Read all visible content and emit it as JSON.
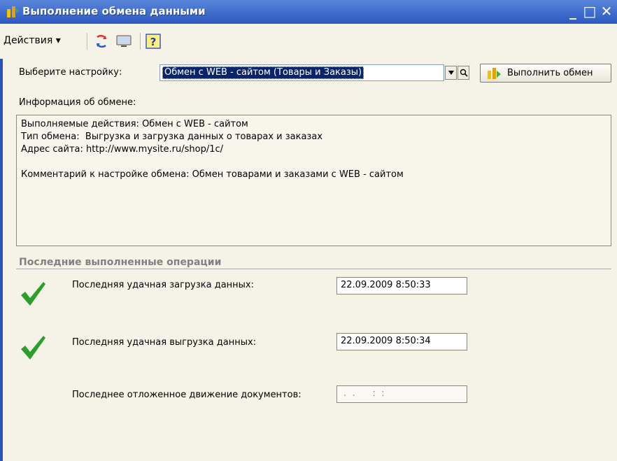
{
  "window": {
    "title": "Выполнение обмена данными",
    "minimize": "_",
    "maximize": "□",
    "close": "✕"
  },
  "toolbar": {
    "actions_label": "Действия ▾",
    "icons": [
      "refresh-icon",
      "monitor-icon",
      "help-icon"
    ]
  },
  "setting": {
    "label": "Выберите настройку:",
    "selected_value": "Обмен с WEB - сайтом (Товары и Заказы)",
    "execute_label": "Выполнить обмен"
  },
  "info": {
    "label": "Информация об обмене:",
    "lines": [
      "Выполняемые действия: Обмен с WEB - сайтом",
      "Тип обмена:  Выгрузка и загрузка данных о товарах и заказах",
      "Адрес сайта: http://www.mysite.ru/shop/1c/",
      "",
      "Комментарий к настройке обмена: Обмен товарами и заказами с WEB - сайтом"
    ]
  },
  "last_ops": {
    "title": "Последние выполненные операции",
    "items": [
      {
        "label": "Последняя удачная загрузка данных:",
        "value": "22.09.2009  8:50:33",
        "status": "success"
      },
      {
        "label": "Последняя удачная выгрузка данных:",
        "value": "22.09.2009  8:50:34",
        "status": "success"
      },
      {
        "label": "Последнее отложенное движение документов:",
        "value": " .  .      :  :",
        "status": "none"
      }
    ]
  },
  "colors": {
    "title_bar": "#3f6ccf",
    "selection": "#0a246a",
    "check": "#2aa02a",
    "background": "#f5f3e8"
  }
}
